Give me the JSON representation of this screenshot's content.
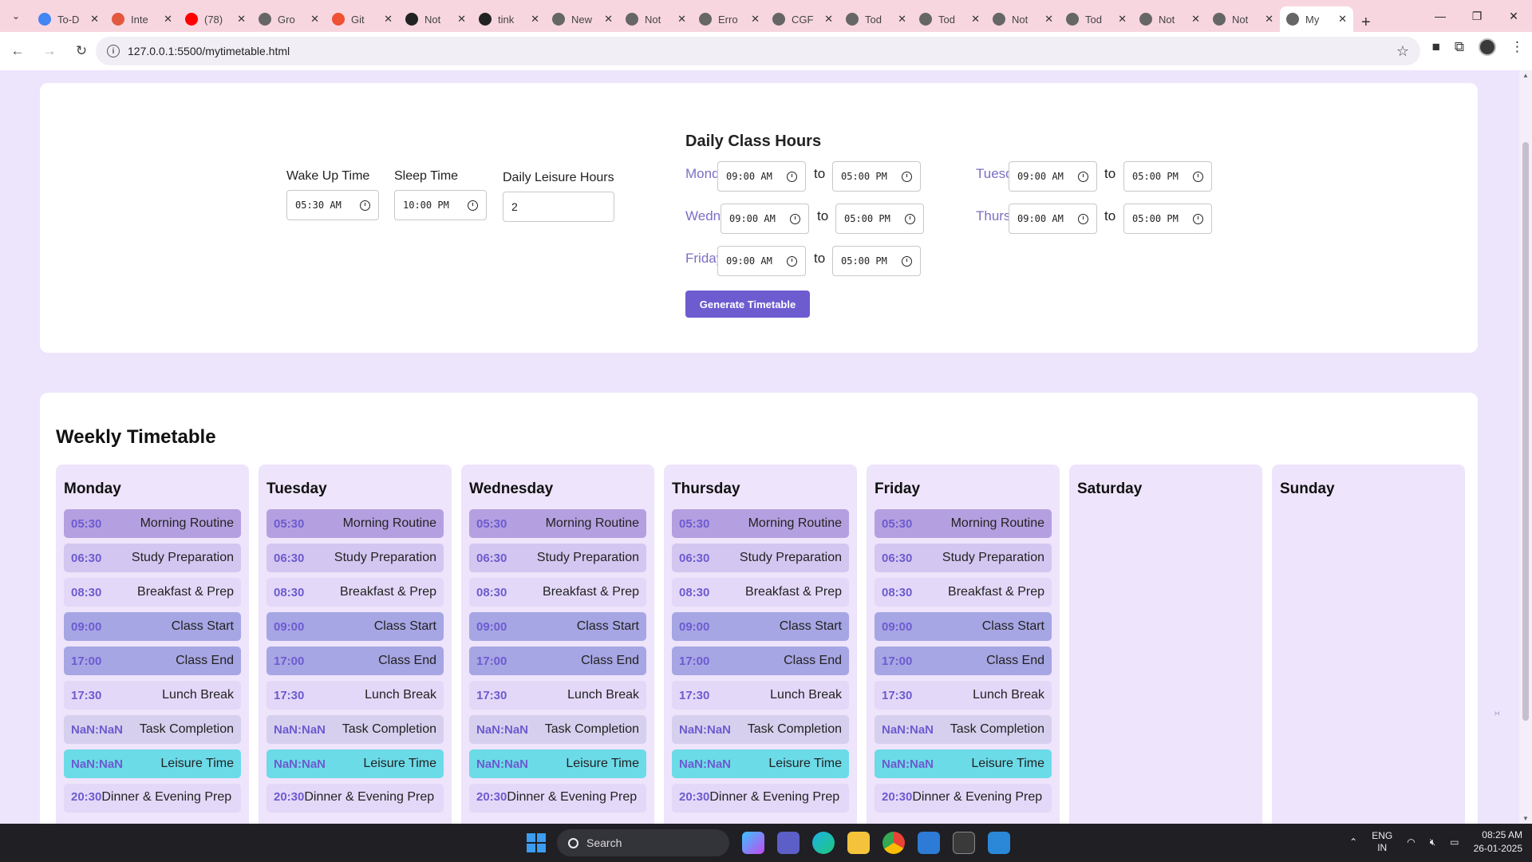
{
  "browser": {
    "tabs": [
      {
        "title": "To-D",
        "color": "#4285f4"
      },
      {
        "title": "Inte",
        "color": "#e2583e"
      },
      {
        "title": "(78)",
        "color": "#ff0000"
      },
      {
        "title": "Gro",
        "color": "#666666"
      },
      {
        "title": "Git",
        "color": "#f05033"
      },
      {
        "title": "Not",
        "color": "#222222"
      },
      {
        "title": "tink",
        "color": "#222222"
      },
      {
        "title": "New",
        "color": "#666666"
      },
      {
        "title": "Not",
        "color": "#666666"
      },
      {
        "title": "Erro",
        "color": "#666666"
      },
      {
        "title": "CGF",
        "color": "#666666"
      },
      {
        "title": "Tod",
        "color": "#666666"
      },
      {
        "title": "Tod",
        "color": "#666666"
      },
      {
        "title": "Not",
        "color": "#666666"
      },
      {
        "title": "Tod",
        "color": "#666666"
      },
      {
        "title": "Not",
        "color": "#666666"
      },
      {
        "title": "Not",
        "color": "#666666"
      },
      {
        "title": "My",
        "color": "#666666",
        "active": true
      }
    ],
    "url": "127.0.0.1:5500/mytimetable.html"
  },
  "form": {
    "wake_label": "Wake Up Time",
    "wake_value": "05:30 AM",
    "sleep_label": "Sleep Time",
    "sleep_value": "10:00 PM",
    "leisure_label": "Daily Leisure Hours",
    "leisure_value": "2",
    "class_title": "Daily Class Hours",
    "to": "to",
    "days": {
      "monday": {
        "label": "Monday",
        "start": "09:00 AM",
        "end": "05:00 PM"
      },
      "tuesday": {
        "label": "Tuesday",
        "start": "09:00 AM",
        "end": "05:00 PM"
      },
      "wednesday": {
        "label": "Wednesday",
        "start": "09:00 AM",
        "end": "05:00 PM"
      },
      "thursday": {
        "label": "Thursday",
        "start": "09:00 AM",
        "end": "05:00 PM"
      },
      "friday": {
        "label": "Friday",
        "start": "09:00 AM",
        "end": "05:00 PM"
      }
    },
    "generate_label": "Generate Timetable"
  },
  "timetable": {
    "title": "Weekly Timetable",
    "days": [
      "Monday",
      "Tuesday",
      "Wednesday",
      "Thursday",
      "Friday",
      "Saturday",
      "Sunday"
    ],
    "slots": [
      {
        "time": "05:30",
        "activity": "Morning Routine"
      },
      {
        "time": "06:30",
        "activity": "Study Preparation"
      },
      {
        "time": "08:30",
        "activity": "Breakfast & Prep"
      },
      {
        "time": "09:00",
        "activity": "Class Start"
      },
      {
        "time": "17:00",
        "activity": "Class End"
      },
      {
        "time": "17:30",
        "activity": "Lunch Break"
      },
      {
        "time": "NaN:NaN",
        "activity": "Task Completion"
      },
      {
        "time": "NaN:NaN",
        "activity": "Leisure Time"
      },
      {
        "time": "20:30",
        "activity": "Dinner & Evening Prep"
      }
    ]
  },
  "taskbar": {
    "search": "Search",
    "lang_1": "ENG",
    "lang_2": "IN",
    "time": "08:25 AM",
    "date": "26-01-2025"
  }
}
